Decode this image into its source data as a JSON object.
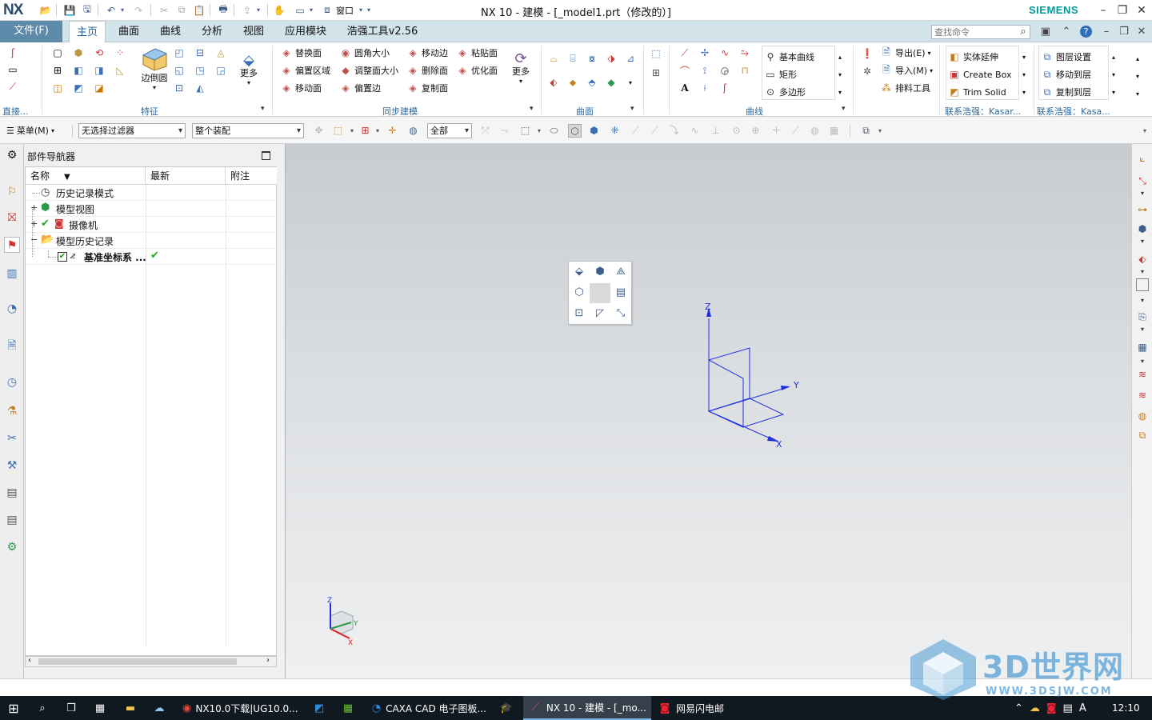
{
  "window": {
    "app_logo": "NX",
    "title": "NX 10 - 建模 - [_model1.prt（修改的）]",
    "brand": "SIEMENS",
    "window_menu": "窗口",
    "controls": {
      "minimize": "–",
      "restore": "❐",
      "close": "✕"
    }
  },
  "tabs": {
    "file": "文件(F)",
    "items": [
      "主页",
      "曲面",
      "曲线",
      "分析",
      "视图",
      "应用模块",
      "浩强工具v2.56"
    ],
    "active": "主页",
    "search_placeholder": "查找命令"
  },
  "ribbon": {
    "group_direct": "直接...",
    "group_feature": "特征",
    "edge_blend": "边倒圆",
    "more1": "更多",
    "sync": {
      "items": [
        "替换面",
        "圆角大小",
        "移动边",
        "粘贴面",
        "偏置区域",
        "调整面大小",
        "删除面",
        "优化面",
        "移动面",
        "偏置边",
        "复制面"
      ],
      "more": "更多",
      "label": "同步建模"
    },
    "group_surface": "曲面",
    "curve": {
      "items": [
        "基本曲线",
        "矩形",
        "多边形"
      ],
      "label": "曲线"
    },
    "io": {
      "export": "导出(E)",
      "import": "导入(M)",
      "nest": "排料工具"
    },
    "kasar1": {
      "items": [
        "实体延伸",
        "Create Box",
        "Trim Solid"
      ],
      "label": "联系浩强：Kasar..."
    },
    "kasar2": {
      "items": [
        "图层设置",
        "移动到层",
        "复制到层"
      ],
      "label": "联系浩强：Kasa..."
    }
  },
  "toolbar2": {
    "menu": "菜单(M)",
    "filter": "无选择过滤器",
    "assembly": "整个装配",
    "scope": "全部"
  },
  "navigator": {
    "title": "部件导航器",
    "columns": [
      "名称",
      "最新",
      "附注"
    ],
    "rows": [
      {
        "label": "历史记录模式",
        "latest": ""
      },
      {
        "label": "模型视图",
        "latest": ""
      },
      {
        "label": "摄像机",
        "latest": ""
      },
      {
        "label": "模型历史记录",
        "latest": ""
      },
      {
        "label": "基准坐标系 ...",
        "latest": "✔"
      }
    ]
  },
  "viewport": {
    "axis_labels": {
      "z": "Z",
      "y": "Y",
      "x": "X"
    },
    "mini_axis_labels": {
      "z": "Z",
      "y": "Y",
      "x": "X"
    }
  },
  "taskbar": {
    "items": [
      {
        "label": "NX10.0下载|UG10.0...",
        "icon": "chrome-icon",
        "active": false
      },
      {
        "label": "CAXA CAD 电子图板...",
        "icon": "caxa-icon",
        "active": false
      },
      {
        "label": "NX 10 - 建模 - [_mo...",
        "icon": "nx-icon",
        "active": true
      },
      {
        "label": "网易闪电邮",
        "icon": "mail-icon",
        "active": false
      }
    ],
    "tray_ime": "A",
    "clock": "12:10"
  },
  "watermark": {
    "text": "3D世界网",
    "url": "WWW.3DSJW.COM"
  },
  "colors": {
    "file_tab": "#5d8aa8",
    "ribbon_tabs_bg": "#d3e3ea",
    "axis_blue": "#1f2fe0",
    "brand": "#009999",
    "group_label": "#2c6aa0",
    "taskbar": "#101820"
  }
}
